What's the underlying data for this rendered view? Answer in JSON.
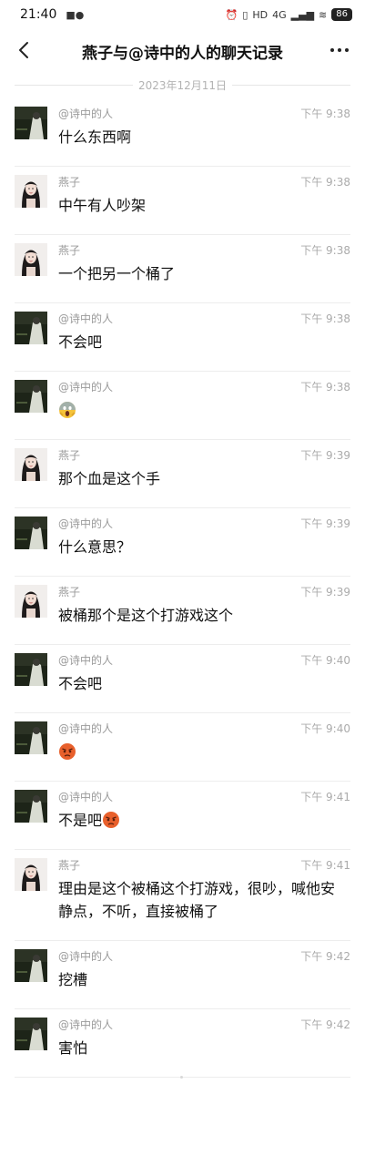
{
  "status_bar": {
    "time": "21:40",
    "battery": "86",
    "network": "4G"
  },
  "header": {
    "title": "燕子与@诗中的人的聊天记录"
  },
  "date_divider": "2023年12月11日",
  "messages": [
    {
      "sender": "@诗中的人",
      "time": "下午 9:38",
      "text": "什么东西啊"
    },
    {
      "sender": "燕子",
      "time": "下午 9:38",
      "text": "中午有人吵架"
    },
    {
      "sender": "燕子",
      "time": "下午 9:38",
      "text": "一个把另一个桶了"
    },
    {
      "sender": "@诗中的人",
      "time": "下午 9:38",
      "text": "不会吧"
    },
    {
      "sender": "@诗中的人",
      "time": "下午 9:38",
      "text": ""
    },
    {
      "sender": "燕子",
      "time": "下午 9:39",
      "text": "那个血是这个手"
    },
    {
      "sender": "@诗中的人",
      "time": "下午 9:39",
      "text": "什么意思？"
    },
    {
      "sender": "燕子",
      "time": "下午 9:39",
      "text": "被桶那个是这个打游戏这个"
    },
    {
      "sender": "@诗中的人",
      "time": "下午 9:40",
      "text": "不会吧"
    },
    {
      "sender": "@诗中的人",
      "time": "下午 9:40",
      "text": ""
    },
    {
      "sender": "@诗中的人",
      "time": "下午 9:41",
      "text": "不是吧"
    },
    {
      "sender": "燕子",
      "time": "下午 9:41",
      "text": "理由是这个被桶这个打游戏，很吵，喊他安静点，不听，直接被桶了"
    },
    {
      "sender": "@诗中的人",
      "time": "下午 9:42",
      "text": "挖槽"
    },
    {
      "sender": "@诗中的人",
      "time": "下午 9:42",
      "text": "害怕"
    }
  ]
}
